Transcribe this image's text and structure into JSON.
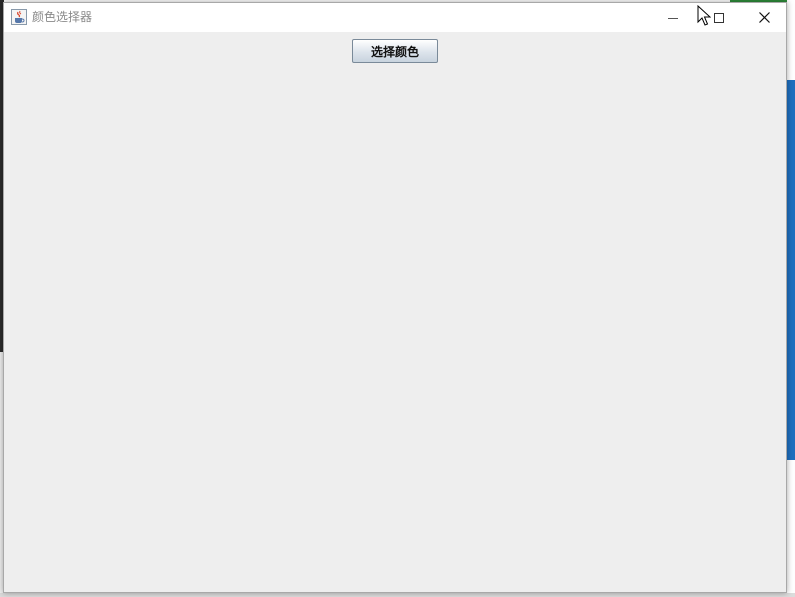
{
  "window": {
    "title": "颜色选择器"
  },
  "icons": {
    "app": "java-cup-icon",
    "minimize": "minimize-icon",
    "maximize": "maximize-icon",
    "close": "close-icon",
    "cursor": "mouse-pointer-icon"
  },
  "content": {
    "choose_color_label": "选择颜色"
  },
  "colors": {
    "titlebar": "#ffffff",
    "client_area": "#eeeeee",
    "title_text": "#8a8a8a"
  }
}
